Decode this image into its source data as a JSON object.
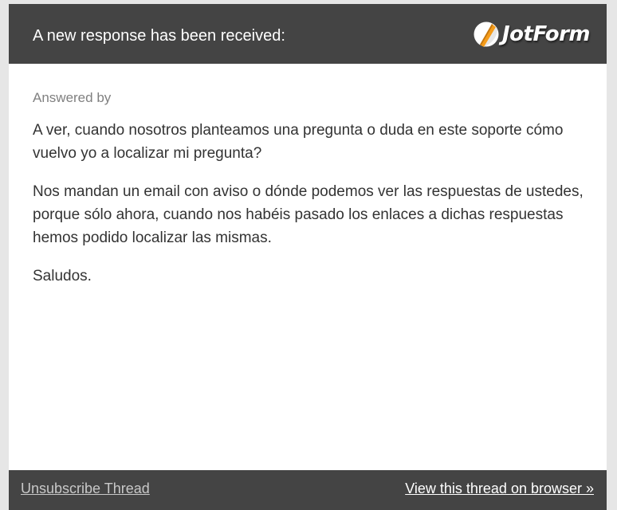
{
  "colors": {
    "header_bg": "#444444",
    "footer_bg": "#444444",
    "page_bg": "#e6e6e6",
    "card_bg": "#ffffff",
    "body_text": "#333333",
    "muted_text": "#808080",
    "logo_accent": "#f59c1a"
  },
  "header": {
    "title": "A new response has been received:",
    "logo_text": "JotForm",
    "logo_icon": "jotform-pencil-icon"
  },
  "body": {
    "answered_by_label": "Answered by",
    "paragraphs": [
      "A ver, cuando nosotros planteamos una pregunta o duda en este soporte cómo vuelvo yo a localizar mi pregunta?",
      "Nos mandan un email con aviso o dónde podemos ver las respuestas de ustedes, porque sólo ahora, cuando nos habéis pasado los enlaces a dichas respuestas hemos podido localizar las mismas.",
      "Saludos."
    ]
  },
  "footer": {
    "unsubscribe_label": "Unsubscribe Thread",
    "view_thread_label": "View this thread on browser »"
  }
}
